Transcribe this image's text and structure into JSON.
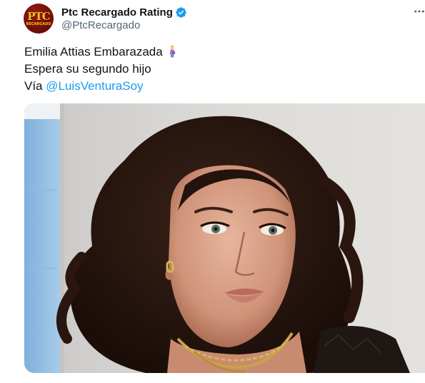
{
  "author": {
    "display_name": "Ptc Recargado Rating",
    "handle": "@PtcRecargado",
    "avatar_text": "PTC",
    "avatar_subtext": "RECARGADO",
    "verified": true,
    "verified_color": "#1d9bf0"
  },
  "tweet": {
    "line1": "Emilia Attias Embarazada",
    "line1_emoji": "pregnant-woman-emoji",
    "line2": "Espera su segundo hijo",
    "line3_prefix": "Vía ",
    "mention": "@LuisVenturaSoy",
    "link_color": "#1d9bf0"
  },
  "media": {
    "description_icon": "photo"
  },
  "menu_icon": "more-horizontal-icon"
}
